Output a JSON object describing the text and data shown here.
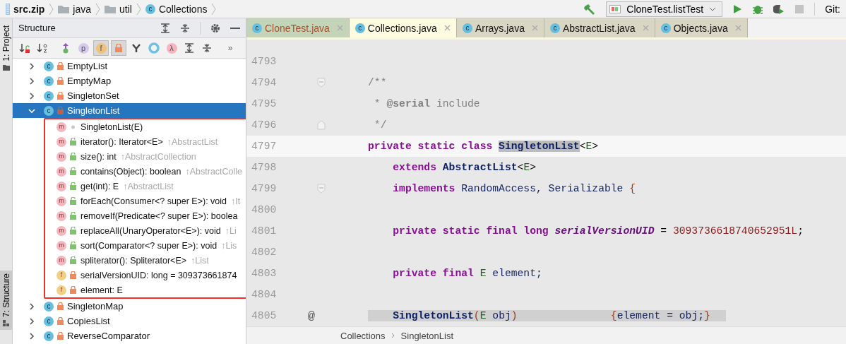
{
  "navbar": {
    "breadcrumb": [
      {
        "label": "src.zip",
        "kind": "archive"
      },
      {
        "label": "java",
        "kind": "folder"
      },
      {
        "label": "util",
        "kind": "folder"
      },
      {
        "label": "Collections",
        "kind": "class",
        "badge": "c"
      }
    ],
    "run_config": "CloneTest.listTest",
    "stop_enabled": false,
    "vcs_label": "Git:"
  },
  "tool_windows": [
    {
      "label": "1: Project",
      "selected": false,
      "kind": "project"
    },
    {
      "label": "7: Structure",
      "selected": true,
      "kind": "structure"
    }
  ],
  "structure": {
    "title": "Structure",
    "toolbar": [
      {
        "kind": "sortvisibility",
        "on": false
      },
      {
        "kind": "sortalpha",
        "on": false
      },
      {
        "kind": "inherited",
        "on": false
      },
      {
        "kind": "letter",
        "glyph": "p",
        "color": "#d7c8ee",
        "on": false
      },
      {
        "kind": "letter",
        "glyph": "f",
        "color": "#efc27c",
        "on": true
      },
      {
        "kind": "lock",
        "on": true
      },
      {
        "kind": "anonymous",
        "on": false
      },
      {
        "kind": "ring",
        "on": false
      },
      {
        "kind": "letter",
        "glyph": "λ",
        "color": "#f5b4c0",
        "on": false
      },
      {
        "kind": "expand",
        "on": false
      },
      {
        "kind": "collapse",
        "on": false
      },
      {
        "kind": "more",
        "glyph": "»",
        "on": false
      }
    ],
    "tree": [
      {
        "label": "EmptyList",
        "badge": "c",
        "kind": "private",
        "expanded": false,
        "selected": false
      },
      {
        "label": "EmptyMap",
        "badge": "c",
        "kind": "private",
        "expanded": false,
        "selected": false
      },
      {
        "label": "SingletonSet",
        "badge": "c",
        "kind": "private",
        "expanded": false,
        "selected": false
      },
      {
        "label": "SingletonList",
        "badge": "c",
        "kind": "private",
        "expanded": true,
        "selected": true,
        "highlighted": true,
        "children": [
          {
            "label": "SingletonList(E)",
            "badge": "m",
            "kind": "package",
            "selected": false
          },
          {
            "label": "iterator(): Iterator<E>",
            "inherited": "↑AbstractList",
            "badge": "m",
            "kind": "public",
            "selected": false
          },
          {
            "label": "size(): int",
            "inherited": "↑AbstractCollection",
            "badge": "m",
            "kind": "public",
            "selected": false
          },
          {
            "label": "contains(Object): boolean",
            "inherited": "↑AbstractColle",
            "badge": "m",
            "kind": "public",
            "selected": false
          },
          {
            "label": "get(int): E",
            "inherited": "↑AbstractList",
            "badge": "m",
            "kind": "public",
            "selected": false
          },
          {
            "label": "forEach(Consumer<? super E>): void",
            "inherited": "↑It",
            "badge": "m",
            "kind": "public",
            "selected": false
          },
          {
            "label": "removeIf(Predicate<? super E>): boolea",
            "badge": "m",
            "kind": "public",
            "selected": false
          },
          {
            "label": "replaceAll(UnaryOperator<E>): void",
            "inherited": "↑Li",
            "badge": "m",
            "kind": "public",
            "selected": false
          },
          {
            "label": "sort(Comparator<? super E>): void",
            "inherited": "↑Lis",
            "badge": "m",
            "kind": "public",
            "selected": false
          },
          {
            "label": "spliterator(): Spliterator<E>",
            "inherited": "↑List",
            "badge": "m",
            "kind": "public",
            "selected": false
          },
          {
            "label": "serialVersionUID: long = 309373661874",
            "badge": "f",
            "kind": "private",
            "selected": false
          },
          {
            "label": "element: E",
            "badge": "f",
            "kind": "private",
            "selected": false
          }
        ]
      },
      {
        "label": "SingletonMap",
        "badge": "c",
        "kind": "private",
        "expanded": false,
        "selected": false
      },
      {
        "label": "CopiesList",
        "badge": "c",
        "kind": "private",
        "expanded": false,
        "selected": false
      },
      {
        "label": "ReverseComparator",
        "badge": "c",
        "kind": "private",
        "expanded": false,
        "selected": false
      }
    ]
  },
  "editor": {
    "tabs": [
      {
        "label": "CloneTest.java",
        "kind": "test",
        "badge": "c",
        "selected": false
      },
      {
        "label": "Collections.java",
        "kind": "library",
        "badge": "c",
        "selected": true
      },
      {
        "label": "Arrays.java",
        "kind": "library",
        "badge": "c",
        "selected": false
      },
      {
        "label": "AbstractList.java",
        "kind": "library",
        "badge": "c",
        "selected": false
      },
      {
        "label": "Objects.java",
        "kind": "library",
        "badge": "c",
        "selected": false
      }
    ],
    "lines": [
      {
        "number": "4793",
        "current": false
      },
      {
        "number": "4794",
        "current": false,
        "fold_start": true,
        "folded": false,
        "tokens": [
          {
            "t": "/**",
            "kind": "comment"
          }
        ]
      },
      {
        "number": "4795",
        "current": false,
        "folded": false,
        "tokens": [
          {
            "t": " * ",
            "kind": "comment"
          },
          {
            "t": "@serial",
            "kind": "doctag"
          },
          {
            "t": " include",
            "kind": "comment"
          }
        ]
      },
      {
        "number": "4796",
        "current": false,
        "fold_end": true,
        "folded": false,
        "tokens": [
          {
            "t": " */",
            "kind": "comment"
          }
        ]
      },
      {
        "number": "4797",
        "current": true,
        "folded": false,
        "tokens": [
          {
            "t": "private static class ",
            "kind": "kw"
          },
          {
            "t": "SingletonList",
            "kind": "marked"
          },
          {
            "t": "<",
            "kind": "plain"
          },
          {
            "t": "E",
            "kind": "gen"
          },
          {
            "t": ">",
            "kind": "plain"
          }
        ]
      },
      {
        "number": "4798",
        "current": false,
        "folded": false,
        "tokens": [
          {
            "t": "    extends ",
            "kind": "kw"
          },
          {
            "t": "AbstractList",
            "kind": "cls"
          },
          {
            "t": "<",
            "kind": "plain"
          },
          {
            "t": "E",
            "kind": "gen"
          },
          {
            "t": ">",
            "kind": "plain"
          }
        ]
      },
      {
        "number": "4799",
        "current": false,
        "fold_start": true,
        "folded": false,
        "tokens": [
          {
            "t": "    implements ",
            "kind": "kw"
          },
          {
            "t": "RandomAccess, Serializable ",
            "kind": "type"
          },
          {
            "t": "{",
            "kind": "brace"
          }
        ]
      },
      {
        "number": "4800",
        "current": false
      },
      {
        "number": "4801",
        "current": false,
        "folded": false,
        "tokens": [
          {
            "t": "    private static final long ",
            "kind": "kw"
          },
          {
            "t": "serialVersionUID",
            "kind": "field"
          },
          {
            "t": " = ",
            "kind": "plain"
          },
          {
            "t": "3093736618740652951L",
            "kind": "num"
          },
          {
            "t": ";",
            "kind": "plain"
          }
        ]
      },
      {
        "number": "4802",
        "current": false
      },
      {
        "number": "4803",
        "current": false,
        "folded": false,
        "tokens": [
          {
            "t": "    private final ",
            "kind": "kw"
          },
          {
            "t": "E",
            "kind": "gen"
          },
          {
            "t": " element;",
            "kind": "type"
          }
        ]
      },
      {
        "number": "4804",
        "current": false
      },
      {
        "number": "4805",
        "current": false,
        "folded": true,
        "gutter_mark": "@",
        "tokens": [
          {
            "t": "    SingletonList",
            "kind": "cls"
          },
          {
            "t": "(",
            "kind": "brace"
          },
          {
            "t": "E",
            "kind": "gen"
          },
          {
            "t": " obj",
            "kind": "type"
          },
          {
            "t": ")               ",
            "kind": "brace"
          },
          {
            "t": "{",
            "kind": "brace"
          },
          {
            "t": "element = obj;",
            "kind": "type"
          },
          {
            "t": "}",
            "kind": "brace"
          }
        ]
      }
    ],
    "breadcrumb": [
      "Collections",
      "SingletonList"
    ]
  }
}
